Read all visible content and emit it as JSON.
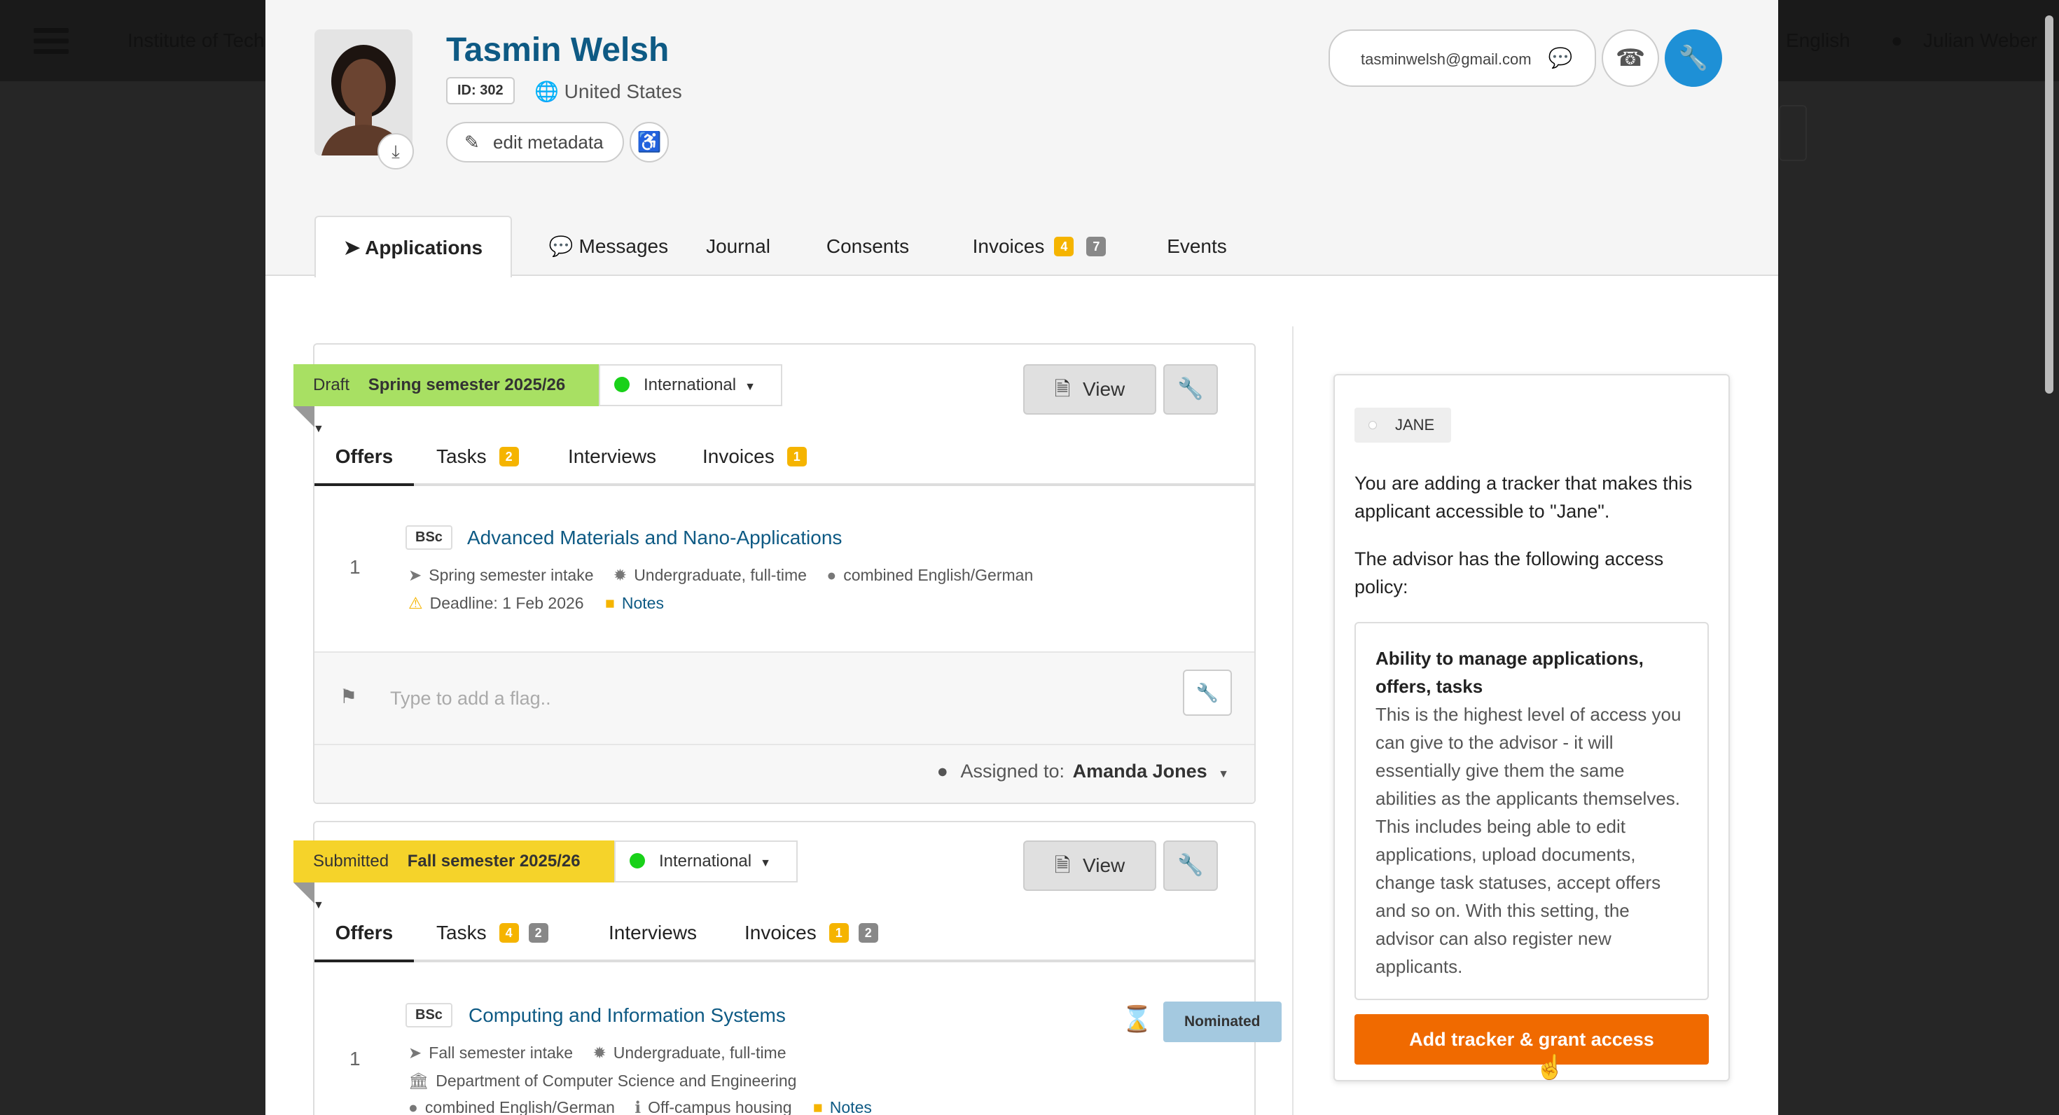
{
  "background": {
    "org_name": "Institute of Technology",
    "language": "English",
    "user_name": "Julian Weber"
  },
  "profile": {
    "name": "Tasmin Welsh",
    "id_label": "ID: 302",
    "country": "United States",
    "edit_metadata": "edit metadata",
    "email": "tasminwelsh@gmail.com"
  },
  "tabs": [
    {
      "label": "Applications"
    },
    {
      "label": "Messages"
    },
    {
      "label": "Journal"
    },
    {
      "label": "Consents"
    },
    {
      "label": "Invoices",
      "badge1": "4",
      "badge2": "7"
    },
    {
      "label": "Events"
    }
  ],
  "app1": {
    "status": "Draft",
    "semester": "Spring semester 2025/26",
    "category": "International",
    "view": "View",
    "subtabs": {
      "offers": "Offers",
      "tasks": "Tasks",
      "tasks_badge": "2",
      "interviews": "Interviews",
      "invoices": "Invoices",
      "invoices_badge": "1"
    },
    "offer": {
      "num": "1",
      "degree": "BSc",
      "program": "Advanced Materials and Nano-Applications",
      "intake": "Spring semester intake",
      "level": "Undergraduate, full-time",
      "language": "combined English/German",
      "deadline": "Deadline: 1 Feb 2026",
      "notes": "Notes"
    },
    "flag_placeholder": "Type to add a flag..",
    "assigned_label": "Assigned to:",
    "assigned_name": "Amanda Jones"
  },
  "app2": {
    "status": "Submitted",
    "semester": "Fall semester 2025/26",
    "category": "International",
    "view": "View",
    "subtabs": {
      "offers": "Offers",
      "tasks": "Tasks",
      "tasks_badge1": "4",
      "tasks_badge2": "2",
      "interviews": "Interviews",
      "invoices": "Invoices",
      "invoices_badge1": "1",
      "invoices_badge2": "2"
    },
    "offer": {
      "num": "1",
      "degree": "BSc",
      "program": "Computing and Information Systems",
      "status": "Nominated",
      "intake": "Fall semester intake",
      "level": "Undergraduate, full-time",
      "department": "Department of Computer Science and Engineering",
      "language": "combined English/German",
      "housing": "Off-campus housing",
      "notes": "Notes"
    }
  },
  "tracker": {
    "tag": "JANE",
    "intro": "You are adding a tracker that makes this applicant accessible to \"Jane\".",
    "policy_intro": "The advisor has the following access policy:",
    "policy_title": "Ability to manage applications, offers, tasks",
    "policy_desc": "This is the highest level of access you can give to the advisor - it will essentially give them the same abilities as the applicants themselves. This includes being able to edit applications, upload documents, change task statuses, accept offers and so on. With this setting, the advisor can also register new applicants.",
    "button": "Add tracker & grant access"
  },
  "colors": {
    "accent_blue": "#1e90d6",
    "draft_green": "#a8e063",
    "submitted_yellow": "#f5d32a",
    "action_orange": "#f06a00"
  }
}
